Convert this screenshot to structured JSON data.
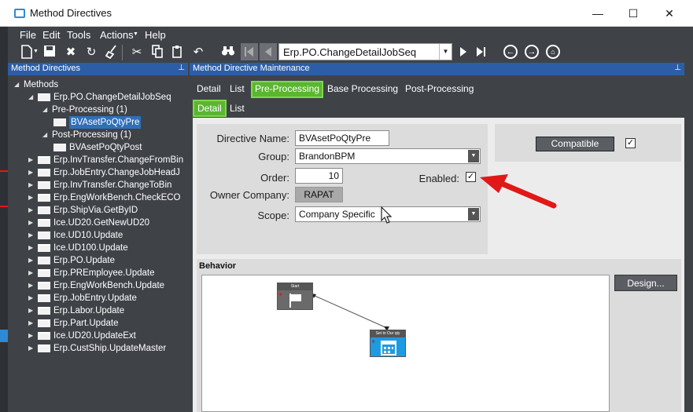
{
  "window": {
    "title": "Method Directives",
    "minimize": "—",
    "maximize": "☐",
    "close": "✕"
  },
  "menu": [
    "File",
    "Edit",
    "Tools",
    "Actions",
    "Help"
  ],
  "toolbar": {
    "nav_value": "Erp.PO.ChangeDetailJobSeq"
  },
  "left_panel": {
    "title": "Method Directives",
    "tree": [
      {
        "label": "Methods",
        "level": 0,
        "expanded": true
      },
      {
        "label": "Erp.PO.ChangeDetailJobSeq",
        "level": 1,
        "expanded": true
      },
      {
        "label": "Pre-Processing (1)",
        "level": 2,
        "expanded": true
      },
      {
        "label": "BVAsetPoQtyPre",
        "level": 3,
        "selected": true
      },
      {
        "label": "Post-Processing (1)",
        "level": 2,
        "expanded": true
      },
      {
        "label": "BVAsetPoQtyPost",
        "level": 3
      },
      {
        "label": "Erp.InvTransfer.ChangeFromBin",
        "level": 1
      },
      {
        "label": "Erp.JobEntry.ChangeJobHeadJ",
        "level": 1
      },
      {
        "label": "Erp.InvTransfer.ChangeToBin",
        "level": 1
      },
      {
        "label": "Erp.EngWorkBench.CheckECO",
        "level": 1
      },
      {
        "label": "Erp.ShipVia.GetByID",
        "level": 1
      },
      {
        "label": "Ice.UD20.GetNewUD20",
        "level": 1
      },
      {
        "label": "Ice.UD10.Update",
        "level": 1
      },
      {
        "label": "Ice.UD100.Update",
        "level": 1
      },
      {
        "label": "Erp.PO.Update",
        "level": 1
      },
      {
        "label": "Erp.PREmployee.Update",
        "level": 1
      },
      {
        "label": "Erp.EngWorkBench.Update",
        "level": 1
      },
      {
        "label": "Erp.JobEntry.Update",
        "level": 1
      },
      {
        "label": "Erp.Labor.Update",
        "level": 1
      },
      {
        "label": "Erp.Part.Update",
        "level": 1
      },
      {
        "label": "Ice.UD20.UpdateExt",
        "level": 1
      },
      {
        "label": "Erp.CustShip.UpdateMaster",
        "level": 1
      }
    ]
  },
  "right_panel": {
    "title": "Method Directive Maintenance",
    "tabs": [
      "Detail",
      "List",
      "Pre-Processing",
      "Base Processing",
      "Post-Processing"
    ],
    "active_tab": "Pre-Processing",
    "subtabs": [
      "Detail",
      "List"
    ],
    "active_subtab": "Detail",
    "form": {
      "directive_name_label": "Directive Name:",
      "directive_name": "BVAsetPoQtyPre",
      "group_label": "Group:",
      "group": "BrandonBPM",
      "order_label": "Order:",
      "order": "10",
      "enabled_label": "Enabled:",
      "enabled": true,
      "owner_company_label": "Owner Company:",
      "owner_company": "RAPAT",
      "scope_label": "Scope:",
      "scope": "Company Specific",
      "compatible_label": "Compatible",
      "compatible": true
    },
    "behavior": {
      "label": "Behavior",
      "design_button": "Design...",
      "nodes": [
        {
          "title": "Start",
          "icon": "flag-icon"
        },
        {
          "title": "Set to Our qty",
          "icon": "calendar-grid-icon"
        }
      ]
    }
  },
  "colors": {
    "accent_green": "#5cb531",
    "header_blue": "#2c5ea8",
    "dark_bg": "#3f4348",
    "arrow_red": "#e01818"
  }
}
